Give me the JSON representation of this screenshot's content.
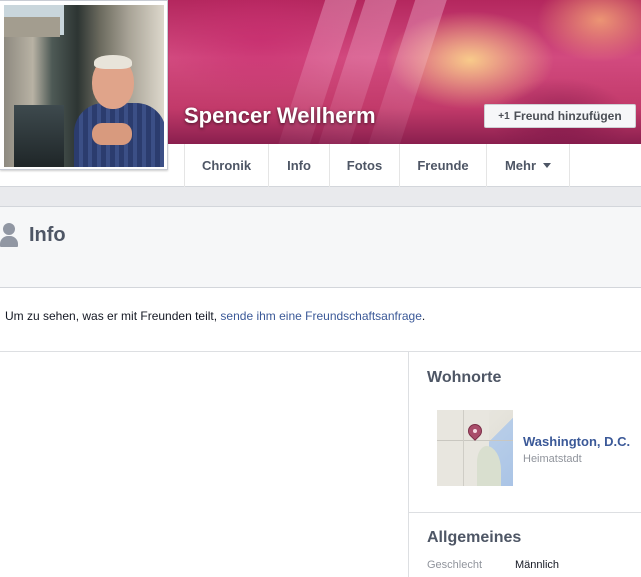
{
  "profile": {
    "name": "Spencer Wellherm",
    "add_friend_icon": "+1",
    "add_friend_label": "Freund hinzufügen"
  },
  "nav": {
    "tabs": [
      "Chronik",
      "Info",
      "Fotos",
      "Freunde",
      "Mehr"
    ]
  },
  "info": {
    "title": "Info",
    "notice_text": "Um zu sehen, was er mit Freunden teilt, ",
    "notice_link": "sende ihm eine Freundschaftsanfrage",
    "notice_end": "."
  },
  "places": {
    "title": "Wohnorte",
    "items": [
      {
        "name": "Washington, D.C.",
        "type": "Heimatstadt"
      }
    ]
  },
  "general": {
    "title": "Allgemeines",
    "fields": [
      {
        "label": "Geschlecht",
        "value": "Männlich"
      }
    ]
  },
  "icons": [
    "person-icon",
    "map-pin-icon",
    "caret-down-icon",
    "plus-one-icon"
  ],
  "colors": {
    "link": "#3b5998",
    "tab_text": "#4e5665",
    "page_bg": "#e9eaed",
    "cover": "#c23a6a"
  }
}
